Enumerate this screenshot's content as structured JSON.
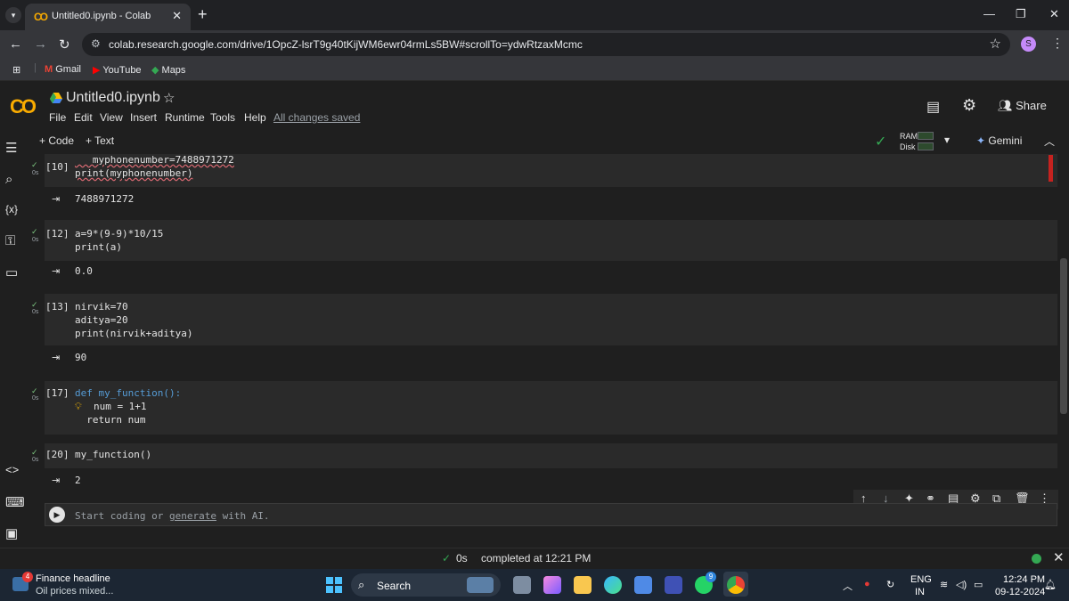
{
  "browser": {
    "tab_title": "Untitled0.ipynb - Colab",
    "tab_icon_text": "CO",
    "url": "colab.research.google.com/drive/1OpcZ-lsrT9g40tKijWM6ewr04rmLs5BW#scrollTo=ydwRtzaxMcmc",
    "profile_initial": "S",
    "bookmarks": [
      {
        "label": "Gmail"
      },
      {
        "label": "YouTube"
      },
      {
        "label": "Maps"
      }
    ]
  },
  "colab": {
    "logo_text": "CO",
    "notebook_title": "Untitled0.ipynb",
    "menu": [
      "File",
      "Edit",
      "View",
      "Insert",
      "Runtime",
      "Tools",
      "Help"
    ],
    "save_status": "All changes saved",
    "share_label": "Share",
    "toolbar": {
      "add_code": "+ Code",
      "add_text": "+ Text",
      "ram_label": "RAM",
      "disk_label": "Disk",
      "gemini_label": "Gemini"
    }
  },
  "cells": [
    {
      "exec": "[10]",
      "time": "0s",
      "lines": [
        "   myphonenumber=7488971272",
        "print(myphonenumber)"
      ],
      "output": "7488971272"
    },
    {
      "exec": "[12]",
      "time": "0s",
      "lines": [
        "a=9*(9-9)*10/15",
        "print(a)"
      ],
      "output": "0.0"
    },
    {
      "exec": "[13]",
      "time": "0s",
      "lines": [
        "nirvik=70",
        "aditya=20",
        "print(nirvik+aditya)"
      ],
      "output": "90"
    },
    {
      "exec": "[17]",
      "time": "0s",
      "lines": [
        "def my_function():",
        "  num = 1+1",
        "  return num"
      ],
      "output": ""
    },
    {
      "exec": "[20]",
      "time": "0s",
      "lines": [
        "my_function()"
      ],
      "output": "2"
    }
  ],
  "new_cell_placeholder_prefix": "Start coding or ",
  "new_cell_placeholder_link": "generate",
  "new_cell_placeholder_suffix": " with AI.",
  "status": {
    "time": "0s",
    "message": "completed at 12:21 PM"
  },
  "taskbar": {
    "weather_badge": "4",
    "news_title": "Finance headline",
    "news_sub": "Oil prices mixed...",
    "search_label": "Search",
    "lang_top": "ENG",
    "lang_bottom": "IN",
    "clock_time": "12:24 PM",
    "clock_date": "09-12-2024",
    "whatsapp_badge": "9"
  }
}
